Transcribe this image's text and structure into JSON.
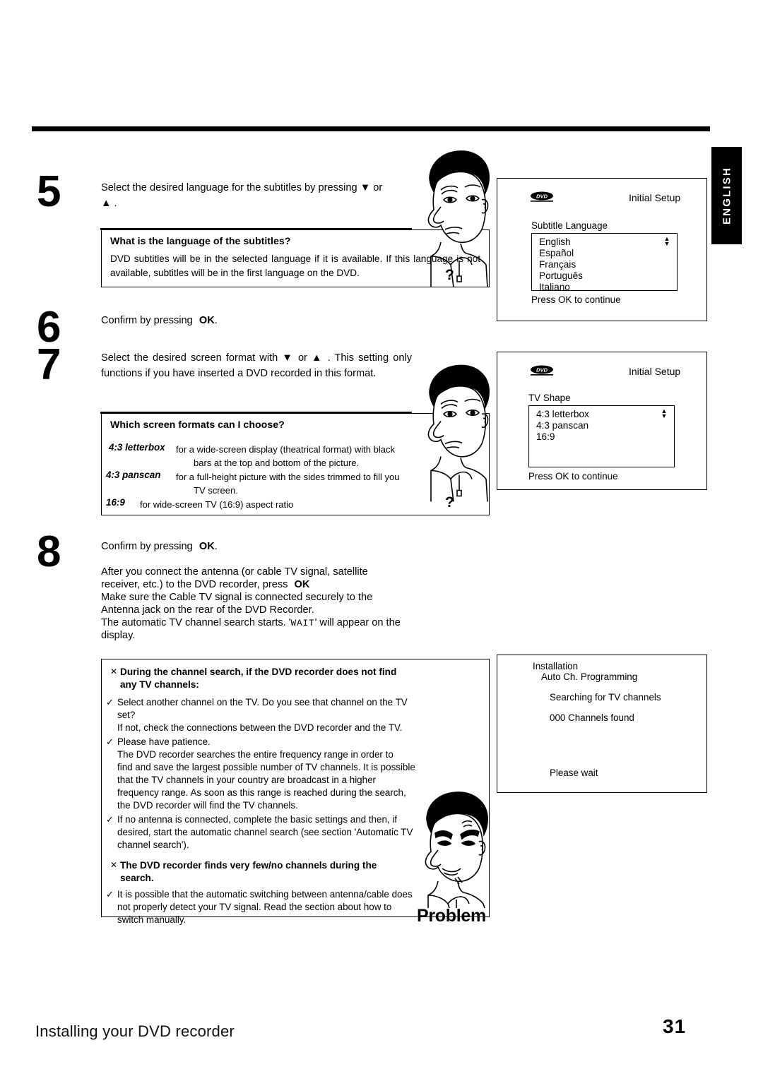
{
  "page": {
    "language_tab": "ENGLISH",
    "footer_title": "Installing your DVD recorder",
    "page_number": "31"
  },
  "steps": [
    {
      "number": "5",
      "text_before": "Select  the  desired  language  for  the  subtitles  by  pressing",
      "text_mid": "or",
      "text_after": "."
    },
    {
      "number": "6",
      "text": "Confirm by pressing",
      "ok": "OK",
      "period": "."
    },
    {
      "number": "7",
      "text": "Select  the  desired  screen  format  with      or      .  This  setting only  functions  if  you  have  inserted  a  DVD  recorded  in  this format."
    },
    {
      "number": "8",
      "text": "Confirm by pressing",
      "ok": "OK",
      "period": "."
    }
  ],
  "step5": {
    "line1": "Select  the  desired  language  for  the  subtitles  by  pressing",
    "or": "or",
    "line2_end": "."
  },
  "step7": {
    "l1a": "Select  the  desired  screen  format  with",
    "or": "or",
    "l1b": ".  This  setting",
    "l2": "only  functions  if  you  have  inserted  a  DVD  recorded  in  this",
    "l3": "format."
  },
  "step8": {
    "confirm": "Confirm by pressing",
    "ok": "OK",
    "period": ".",
    "p1a": "After  you  connect  the  antenna  (or  cable  TV  signal,  satellite",
    "p1b": "receiver, etc.) to the DVD recorder, press",
    "p1ok": "OK",
    "p2a": "Make  sure  the  Cable  TV  signal  is  connected  securely  to  the",
    "p2b": "Antenna jack on the rear of the DVD Recorder.",
    "p3a": "The automatic TV channel search starts. '",
    "p3lcd": "WAIT",
    "p3b": "' will appear on the",
    "p3c": "display."
  },
  "tipbox_subtitles": {
    "heading": "What is the language of the subtitles?",
    "body": "DVD  subtitles  will  be  in  the  selected  language  if  it  is  available.  If  this language  is  not  available,  subtitles  will  be  in  the  first  language  on  the DVD."
  },
  "tipbox_formats": {
    "heading": "Which screen formats can I choose?",
    "rows": [
      {
        "term": "4:3 letterbox",
        "line1": "for a wide-screen display (theatrical format) with black",
        "line2": "bars at the top and bottom of the picture."
      },
      {
        "term": "4:3 panscan",
        "line1": "for a full-height picture with the sides trimmed to fill you",
        "line2": "TV screen."
      },
      {
        "term": "16:9",
        "line1": "for wide-screen TV (16:9) aspect ratio",
        "line2": ""
      }
    ]
  },
  "screen_subtitle_language": {
    "logo": "dvd-logo",
    "header": "Initial Setup",
    "label": "Subtitle Language",
    "options": [
      "English",
      "Español",
      "Français",
      "Português",
      "Italiano"
    ],
    "footer": "Press OK to continue"
  },
  "screen_tv_shape": {
    "logo": "dvd-logo",
    "header": "Initial Setup",
    "label": "TV Shape",
    "options": [
      "4:3 letterbox",
      "4:3 panscan",
      "16:9"
    ],
    "footer": "Press OK to continue"
  },
  "screen_installation": {
    "line1": "Installation",
    "line2": "Auto Ch. Programming",
    "line3": "Searching for TV channels",
    "line4": "000 Channels found",
    "line5": "Please wait"
  },
  "problem_box": {
    "label": "Problem",
    "items": [
      {
        "marker": "x",
        "bold": true,
        "lines": [
          "During  the  channel  search,  if  the  DVD  recorder  does  not  find",
          "any TV channels:"
        ]
      },
      {
        "marker": "check",
        "bold": false,
        "lines": [
          "Select another channel on the TV. Do you see that channel on the TV",
          "set?",
          "If not, check the connections between the DVD recorder and the TV."
        ]
      },
      {
        "marker": "check",
        "bold": false,
        "lines": [
          "Please have patience.",
          "The  DVD  recorder  searches  the  entire  frequency  range  in  order  to",
          "find and save the largest possible number of TV channels. It is possible",
          "that  the  TV  channels  in  your  country  are  broadcast  in  a  higher",
          "frequency  range.  As  soon  as  this  range  is  reached  during  the  search,",
          "the DVD recorder will find the TV channels."
        ]
      },
      {
        "marker": "check",
        "bold": false,
        "lines": [
          "If  no  antenna  is  connected,  complete  the  basic  settings  and  then,  if",
          "desired, start the automatic channel search (see section 'Automatic TV",
          "channel search')."
        ]
      },
      {
        "marker": "x",
        "bold": true,
        "lines": [
          "The  DVD  recorder  finds  very  few/no  channels  during  the",
          "search."
        ]
      },
      {
        "marker": "check",
        "bold": false,
        "lines": [
          "It is possible that the automatic switching between antenna/cable does",
          "not  properly  detect  your  TV  signal.  Read  the  section  about  how  to",
          "switch manually."
        ]
      }
    ]
  },
  "icons": {
    "down_triangle": "▼",
    "up_triangle": "▲",
    "question": "?",
    "x_mark": "✕",
    "check_mark": "✓",
    "updown_arrows": "▲▼"
  }
}
